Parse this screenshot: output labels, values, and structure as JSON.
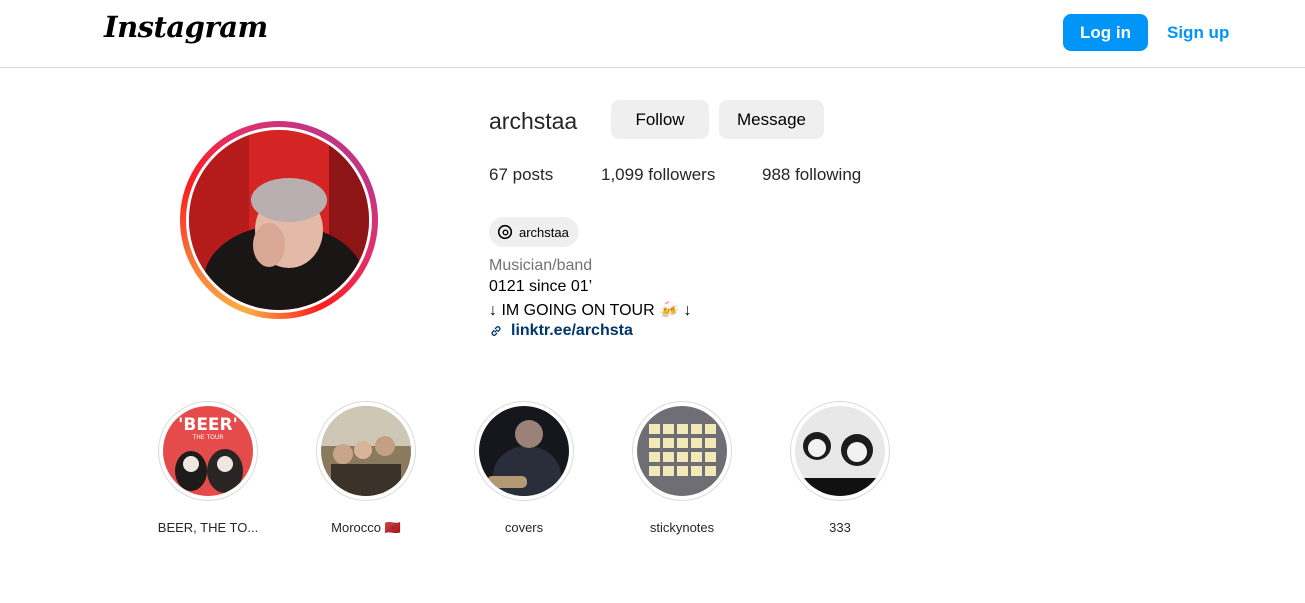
{
  "header": {
    "logo": "Instagram",
    "login_label": "Log in",
    "signup_label": "Sign up"
  },
  "profile": {
    "username": "archstaa",
    "follow_label": "Follow",
    "message_label": "Message",
    "posts": "67 posts",
    "followers": "1,099 followers",
    "following": "988 following",
    "threads_handle": "archstaa",
    "category": "Musician/band",
    "bio_line1": "0121 since 01’",
    "bio_line2": "↓ IM GOING ON TOUR 🍻 ↓",
    "link": "linktr.ee/archsta"
  },
  "highlights": [
    {
      "label": "BEER, THE TO...",
      "cover_text": "'BEER'",
      "cover_sub": "THE TOUR"
    },
    {
      "label": "Morocco 🇲🇦"
    },
    {
      "label": "covers"
    },
    {
      "label": "stickynotes"
    },
    {
      "label": "333"
    }
  ],
  "colors": {
    "accent": "#0095f6",
    "link": "#00376b",
    "button_gray": "#efefef",
    "border": "#dbdbdb"
  }
}
